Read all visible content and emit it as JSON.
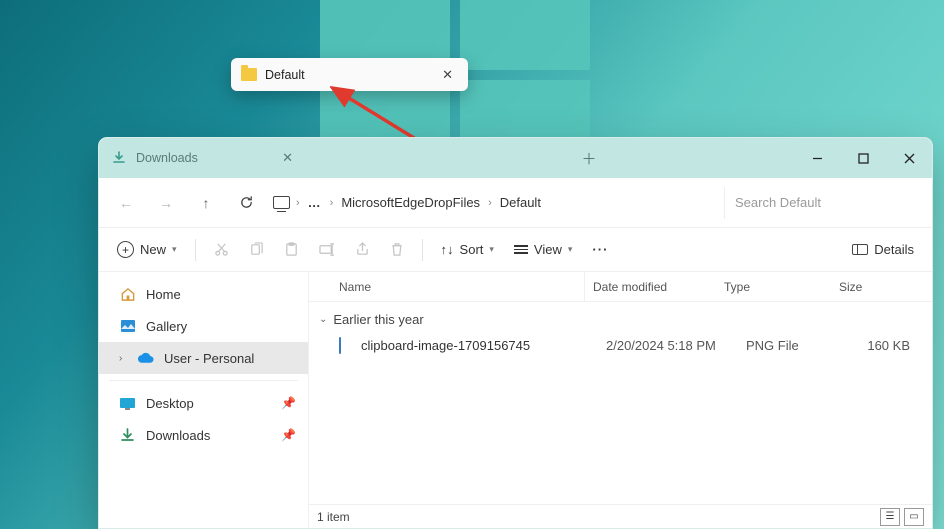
{
  "float_tab": {
    "label": "Default"
  },
  "window": {
    "tabs": [
      {
        "label": "Downloads"
      }
    ],
    "breadcrumb": {
      "seg1": "MicrosoftEdgeDropFiles",
      "seg2": "Default"
    },
    "search_placeholder": "Search Default",
    "toolbar": {
      "new_label": "New",
      "sort_label": "Sort",
      "view_label": "View",
      "details_label": "Details"
    },
    "nav": {
      "home": "Home",
      "gallery": "Gallery",
      "user": "User - Personal",
      "desktop": "Desktop",
      "downloads": "Downloads"
    },
    "columns": {
      "name": "Name",
      "date": "Date modified",
      "type": "Type",
      "size": "Size"
    },
    "group_label": "Earlier this year",
    "files": [
      {
        "name": "clipboard-image-1709156745",
        "date": "2/20/2024 5:18 PM",
        "type": "PNG File",
        "size": "160 KB"
      }
    ],
    "status": "1 item"
  }
}
